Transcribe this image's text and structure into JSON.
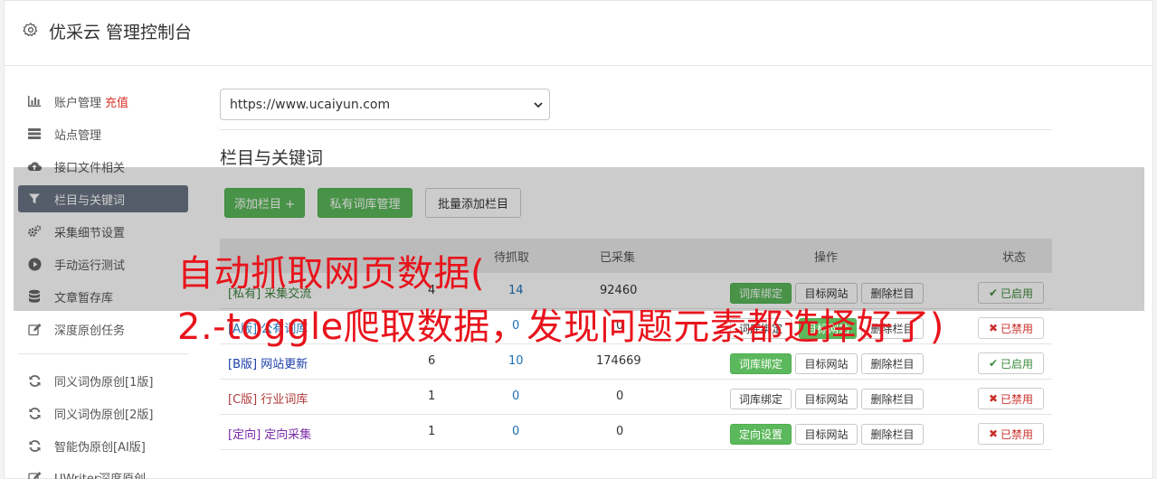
{
  "header": {
    "title": "优采云 管理控制台",
    "icon": "gear-icon"
  },
  "sidebar": {
    "items": [
      {
        "label": "账户管理",
        "extra": "充值",
        "icon": "bar-chart-icon"
      },
      {
        "label": "站点管理",
        "icon": "server-icon"
      },
      {
        "label": "接口文件相关",
        "icon": "cloud-upload-icon"
      },
      {
        "label": "栏目与关键词",
        "icon": "filter-icon",
        "active": true
      },
      {
        "label": "采集细节设置",
        "icon": "cogs-icon"
      },
      {
        "label": "手动运行测试",
        "icon": "play-circle-icon"
      },
      {
        "label": "文章暂存库",
        "icon": "database-icon"
      },
      {
        "label": "深度原创任务",
        "icon": "edit-icon"
      }
    ],
    "items2": [
      {
        "label": "同义词伪原创[1版]",
        "icon": "refresh-icon"
      },
      {
        "label": "同义词伪原创[2版]",
        "icon": "refresh-icon"
      },
      {
        "label": "智能伪原创[AI版]",
        "icon": "refresh-icon"
      },
      {
        "label": "UWriter深度原创",
        "icon": "edit-icon"
      }
    ]
  },
  "site_select": {
    "value": "https://www.ucaiyun.com"
  },
  "section": {
    "title": "栏目与关键词"
  },
  "toolbar": {
    "add_column": "添加栏目 +",
    "private_lib": "私有词库管理",
    "batch_add": "批量添加栏目"
  },
  "table": {
    "headers": [
      "",
      "",
      "待抓取",
      "已采集",
      "操作",
      "状态"
    ],
    "rows": [
      {
        "tag": "[私有]",
        "name": "采集交流",
        "col1": "4",
        "pending": "14",
        "collected": "92460",
        "op1": "词库绑定",
        "op1_green": true,
        "op2": "目标网站",
        "op3": "删除栏目",
        "status": "已启用",
        "on": true
      },
      {
        "tag": "[A版]",
        "name": "公有词库",
        "col1": "",
        "pending": "0",
        "collected": "0",
        "op1": "词库绑定",
        "op1_green": false,
        "op2": "目标网站",
        "op3": "删除栏目",
        "status": "已禁用",
        "on": false
      },
      {
        "tag": "[B版]",
        "name": "网站更新",
        "col1": "6",
        "pending": "10",
        "collected": "174669",
        "op1": "词库绑定",
        "op1_green": true,
        "op2": "目标网站",
        "op3": "删除栏目",
        "status": "已启用",
        "on": true
      },
      {
        "tag": "[C版]",
        "name": "行业词库",
        "col1": "1",
        "pending": "0",
        "collected": "0",
        "op1": "词库绑定",
        "op1_green": false,
        "op2": "目标网站",
        "op3": "删除栏目",
        "status": "已禁用",
        "on": false
      },
      {
        "tag": "[定向]",
        "name": "定向采集",
        "col1": "1",
        "pending": "0",
        "collected": "0",
        "op1": "定向设置",
        "op1_green": true,
        "op2": "目标网站",
        "op3": "删除栏目",
        "status": "已禁用",
        "on": false
      }
    ]
  },
  "overlay": {
    "line1": "自动抓取网页数据(",
    "line2": "2.-toggle爬取数据，发现问题元素都选择好了)"
  },
  "colors": {
    "accent_green": "#5cb85c",
    "active_nav": "#6b7585",
    "caption_red": "#e8141c",
    "link_blue": "#1f6fb3"
  }
}
